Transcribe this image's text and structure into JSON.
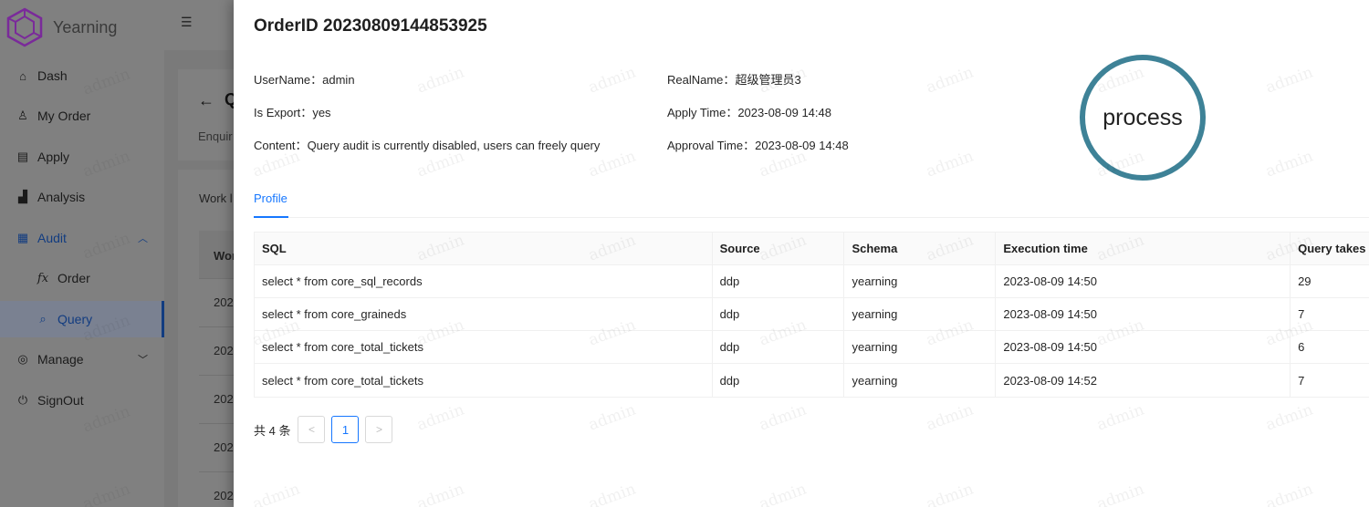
{
  "app": {
    "name": "Yearning",
    "accent": "#123c80",
    "logo_color": "#7a2a9a"
  },
  "sidebar": {
    "items": [
      {
        "label": "Dash",
        "icon": "home-icon"
      },
      {
        "label": "My Order",
        "icon": "user-icon"
      },
      {
        "label": "Apply",
        "icon": "desktop-icon"
      },
      {
        "label": "Analysis",
        "icon": "chart-icon"
      },
      {
        "label": "Audit",
        "icon": "audit-icon",
        "expanded": true
      },
      {
        "label": "Order",
        "icon": "function-icon",
        "sub": true
      },
      {
        "label": "Query",
        "icon": "query-icon",
        "sub": true,
        "selected": true
      },
      {
        "label": "Manage",
        "icon": "manage-icon",
        "expanded": false
      },
      {
        "label": "SignOut",
        "icon": "signout-icon"
      }
    ]
  },
  "background_page": {
    "title_initial": "Q",
    "subtitle_fragment": "Enquir",
    "section_fragment": "Work l",
    "table_header_fragment": "Wor",
    "row_fragments": [
      "202",
      "202",
      "202",
      "202",
      "202"
    ]
  },
  "drawer": {
    "title": "OrderID 20230809144853925",
    "fields": {
      "username": {
        "label": "UserName",
        "value": "admin"
      },
      "realname": {
        "label": "RealName",
        "value": "超级管理员3"
      },
      "is_export": {
        "label": "Is Export",
        "value": "yes"
      },
      "apply_time": {
        "label": "Apply Time",
        "value": "2023-08-09 14:48"
      },
      "content": {
        "label": "Content",
        "value": "Query audit is currently disabled, users can freely query"
      },
      "approval_time": {
        "label": "Approval Time",
        "value": "2023-08-09 14:48"
      }
    },
    "status_stamp": {
      "text": "process",
      "color": "#3e8297"
    },
    "tabs": [
      {
        "label": "Profile",
        "active": true
      }
    ],
    "table": {
      "columns": [
        "SQL",
        "Source",
        "Schema",
        "Execution time",
        "Query takes"
      ],
      "rows": [
        {
          "sql": "select * from core_sql_records",
          "source": "ddp",
          "schema": "yearning",
          "time": "2023-08-09 14:50",
          "takes": "29"
        },
        {
          "sql": "select * from core_graineds",
          "source": "ddp",
          "schema": "yearning",
          "time": "2023-08-09 14:50",
          "takes": "7"
        },
        {
          "sql": "select * from core_total_tickets",
          "source": "ddp",
          "schema": "yearning",
          "time": "2023-08-09 14:50",
          "takes": "6"
        },
        {
          "sql": "select * from core_total_tickets",
          "source": "ddp",
          "schema": "yearning",
          "time": "2023-08-09 14:52",
          "takes": "7"
        }
      ]
    },
    "pagination": {
      "total_text": "共 4 条",
      "current_page": "1",
      "prev": "<",
      "next": ">"
    },
    "watermark": "admin"
  }
}
